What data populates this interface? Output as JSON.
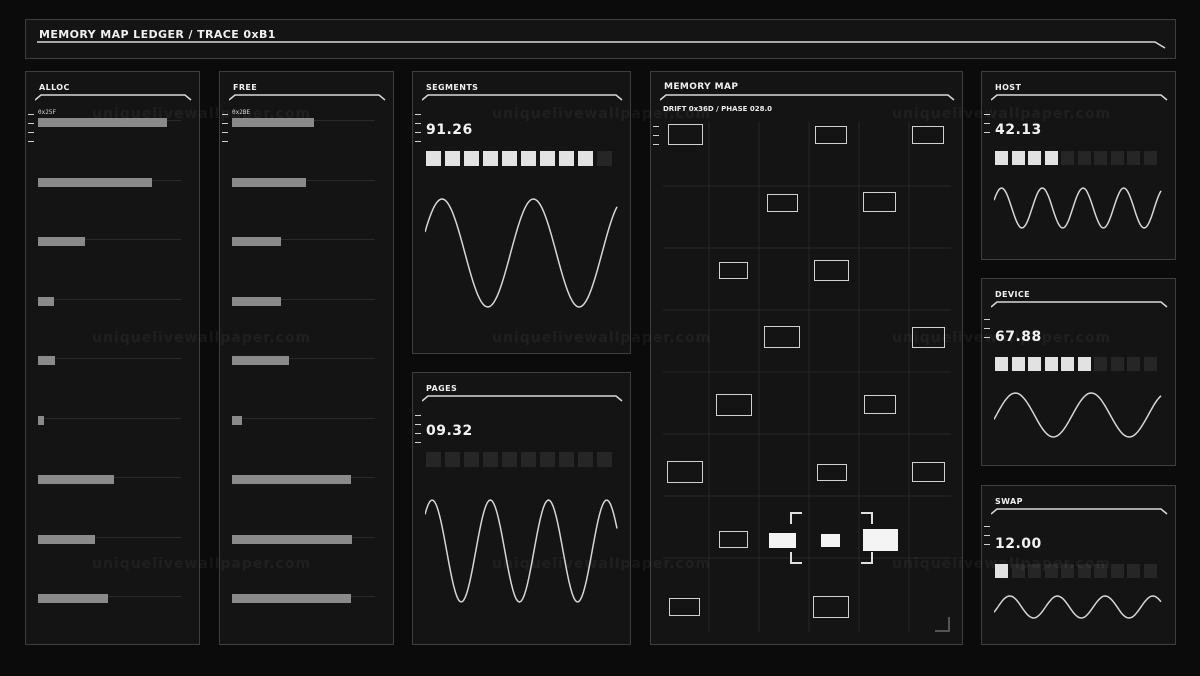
{
  "header": {
    "title": "MEMORY MAP LEDGER / TRACE 0xB1"
  },
  "alloc": {
    "title": "ALLOC",
    "rows": [
      {
        "addr": "0x25F",
        "fill": 0.9,
        "highlight": true
      },
      {
        "addr": "",
        "fill": 0.8,
        "highlight": false
      },
      {
        "addr": "",
        "fill": 0.33,
        "highlight": false
      },
      {
        "addr": "",
        "fill": 0.11,
        "highlight": false
      },
      {
        "addr": "",
        "fill": 0.12,
        "highlight": false
      },
      {
        "addr": "",
        "fill": 0.04,
        "highlight": false
      },
      {
        "addr": "",
        "fill": 0.53,
        "highlight": false
      },
      {
        "addr": "",
        "fill": 0.4,
        "highlight": false
      },
      {
        "addr": "",
        "fill": 0.49,
        "highlight": false
      }
    ]
  },
  "free": {
    "title": "FREE",
    "rows": [
      {
        "addr": "0x2BE",
        "fill": 0.57,
        "highlight": true
      },
      {
        "addr": "",
        "fill": 0.52,
        "highlight": false
      },
      {
        "addr": "",
        "fill": 0.34,
        "highlight": false
      },
      {
        "addr": "",
        "fill": 0.34,
        "highlight": false
      },
      {
        "addr": "",
        "fill": 0.4,
        "highlight": false
      },
      {
        "addr": "",
        "fill": 0.07,
        "highlight": false
      },
      {
        "addr": "",
        "fill": 0.83,
        "highlight": false
      },
      {
        "addr": "",
        "fill": 0.84,
        "highlight": false
      },
      {
        "addr": "",
        "fill": 0.83,
        "highlight": false
      }
    ]
  },
  "segments": {
    "title": "SEGMENTS",
    "value": "91.26",
    "cells_on": 9,
    "cells_total": 10
  },
  "pages": {
    "title": "PAGES",
    "value": "09.32",
    "cells_on": 0,
    "cells_total": 10
  },
  "memory_map": {
    "title": "MEMORY MAP",
    "subtitle": "DRIFT 0x36D / PHASE 028.0"
  },
  "host": {
    "title": "HOST",
    "value": "42.13",
    "cells_on": 4,
    "cells_total": 10
  },
  "device": {
    "title": "DEVICE",
    "value": "67.88",
    "cells_on": 6,
    "cells_total": 10
  },
  "swap": {
    "title": "SWAP",
    "value": "12.00",
    "cells_on": 1,
    "cells_total": 10
  },
  "watermark": "uniquelivewallpaper.com"
}
